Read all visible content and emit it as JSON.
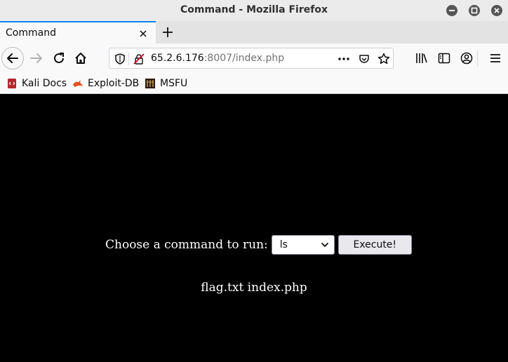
{
  "window": {
    "title": "Command - Mozilla Firefox"
  },
  "tabs": [
    {
      "label": "Command"
    }
  ],
  "navbar": {
    "url_host": "65.2.6.176",
    "url_rest": ":8007/index.php"
  },
  "bookmarks": [
    {
      "label": "Kali Docs",
      "icon": "kali-docs-icon"
    },
    {
      "label": "Exploit-DB",
      "icon": "exploit-db-icon"
    },
    {
      "label": "MSFU",
      "icon": "msfu-icon"
    }
  ],
  "page": {
    "prompt": "Choose a command to run:",
    "selected_command": "ls",
    "execute_label": "Execute!",
    "output": "flag.txt index.php"
  },
  "colors": {
    "page_background": "#000000",
    "page_text": "#ffffff",
    "active_tab_accent": "#0a84ff",
    "exploit_db_orange": "#e8501e",
    "kali_docs_red": "#b5282e"
  }
}
